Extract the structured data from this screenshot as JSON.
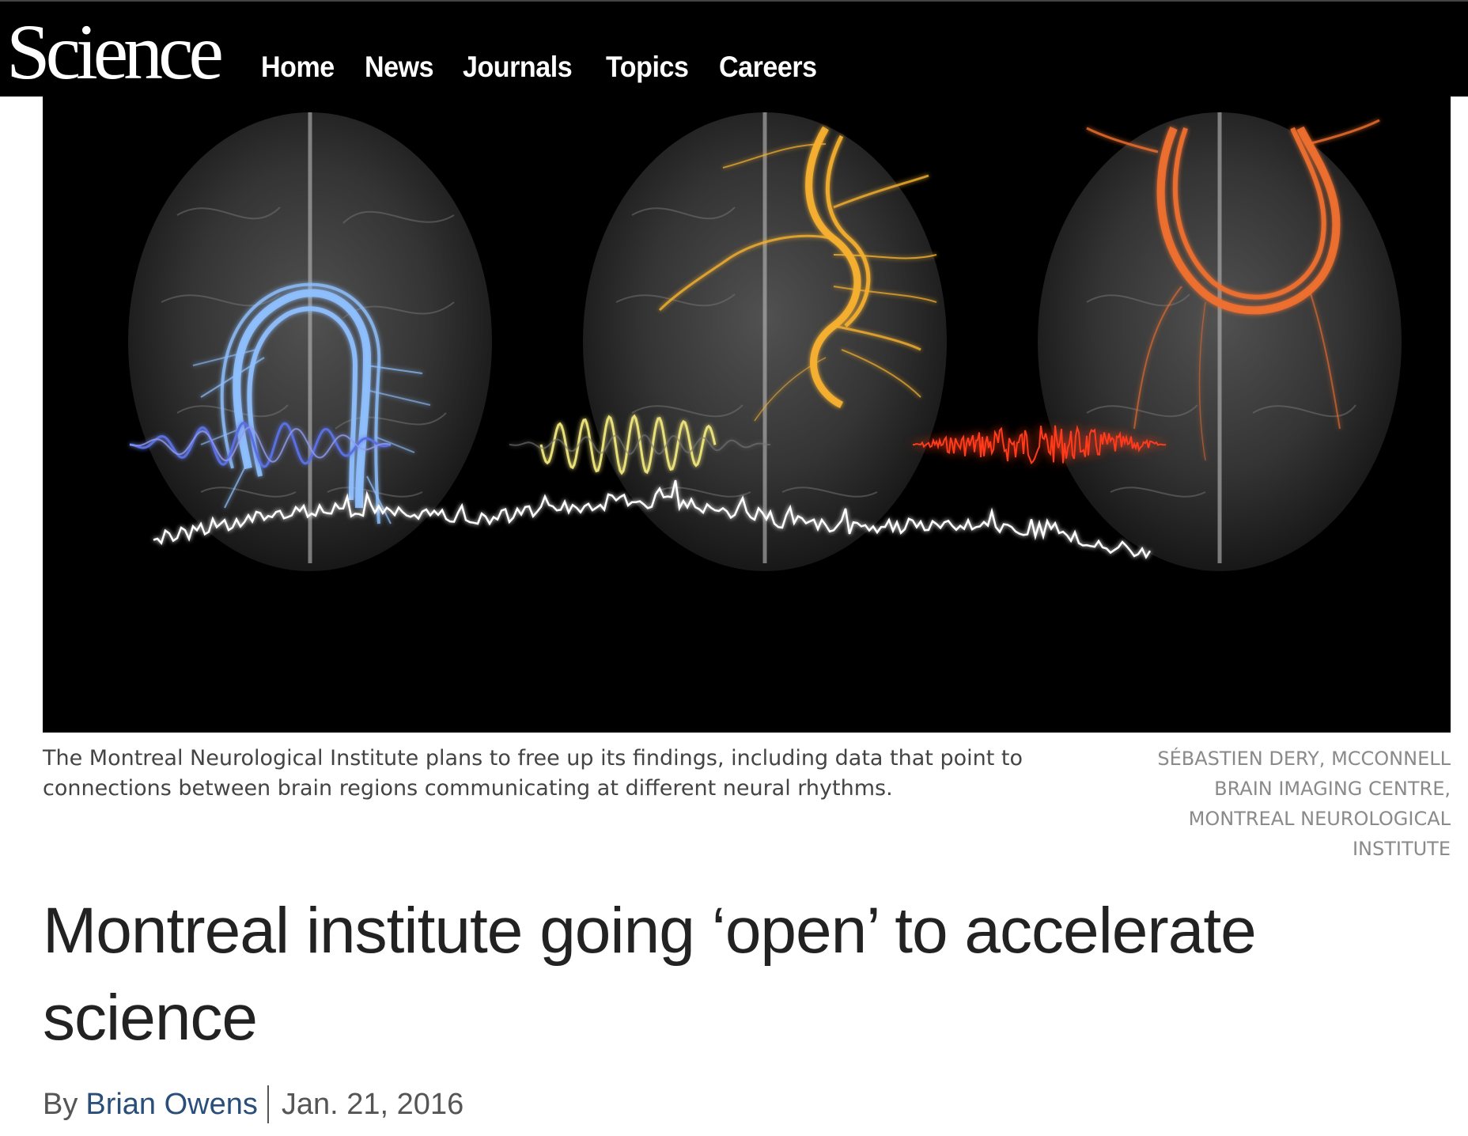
{
  "header": {
    "logo": "Science",
    "nav": [
      "Home",
      "News",
      "Journals",
      "Topics",
      "Careers"
    ]
  },
  "hero": {
    "colors": {
      "left": "#6fa8ff",
      "middle": "#f2a21c",
      "right": "#e8621c",
      "wave_left": "#5a6fe0",
      "wave_middle": "#e9e07a",
      "wave_right": "#ff3a1a",
      "trace": "#ffffff"
    }
  },
  "caption": {
    "text": "The Montreal Neurological Institute plans to free up its findings, including data that point to connections between brain regions communicating at different neural rhythms.",
    "credit": "SÉBASTIEN DERY, MCCONNELL BRAIN IMAGING CENTRE, MONTREAL NEUROLOGICAL INSTITUTE"
  },
  "article": {
    "title": "Montreal institute going ‘open’ to accelerate science",
    "by_prefix": "By",
    "author": "Brian Owens",
    "date": "Jan. 21, 2016"
  }
}
